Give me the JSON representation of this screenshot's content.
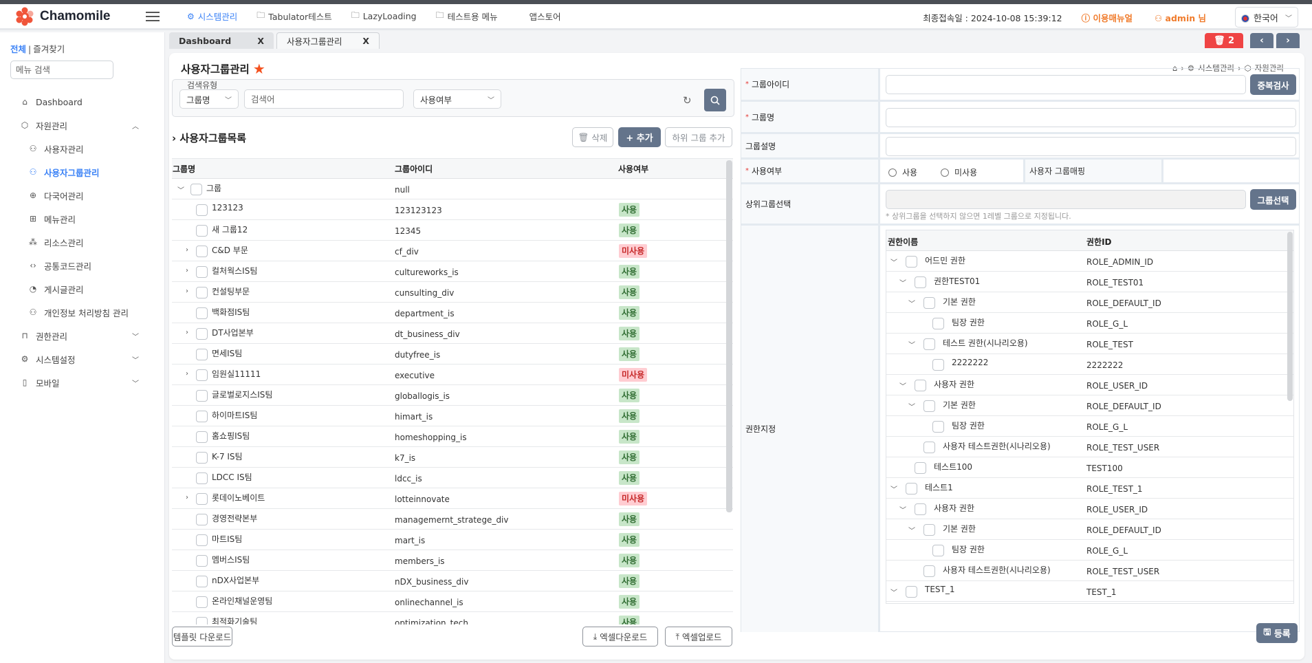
{
  "header": {
    "app_name": "Chamomile",
    "nav": [
      {
        "label": "시스템관리",
        "icon": "gear-icon",
        "active": true
      },
      {
        "label": "Tabulator테스트",
        "icon": "folder-icon"
      },
      {
        "label": "LazyLoading",
        "icon": "folder-icon"
      },
      {
        "label": "테스트용 메뉴",
        "icon": "folder-icon"
      },
      {
        "label": "앱스토어",
        "icon": ""
      }
    ],
    "last_login": "최종접속일 : 2024-10-08 15:39:12",
    "manual_label": "이용매뉴얼",
    "user_label": "admin 님",
    "language": "한국어",
    "accent_color": "#3b82f6",
    "highlight_color": "#f07b2b"
  },
  "sidebar": {
    "tab_all": "전체",
    "tab_separator": "|",
    "tab_favorites": "즐겨찾기",
    "search_placeholder": "메뉴 검색",
    "items": [
      {
        "label": "Dashboard",
        "icon": "home-icon",
        "level": 1
      },
      {
        "label": "자원관리",
        "icon": "cube-icon",
        "level": 1,
        "expanded": true
      },
      {
        "label": "사용자관리",
        "icon": "user-icon",
        "level": 2
      },
      {
        "label": "사용자그룹관리",
        "icon": "users-icon",
        "level": 2,
        "active": true
      },
      {
        "label": "다국어관리",
        "icon": "globe-icon",
        "level": 2
      },
      {
        "label": "메뉴관리",
        "icon": "grid-icon",
        "level": 2
      },
      {
        "label": "리소스관리",
        "icon": "hierarchy-icon",
        "level": 2
      },
      {
        "label": "공통코드관리",
        "icon": "code-icon",
        "level": 2
      },
      {
        "label": "게시글관리",
        "icon": "clipboard-icon",
        "level": 2
      },
      {
        "label": "개인정보 처리방침 관리",
        "icon": "user-icon",
        "level": 2
      },
      {
        "label": "권한관리",
        "icon": "unlock-icon",
        "level": 1,
        "expanded": false
      },
      {
        "label": "시스템설정",
        "icon": "gear-icon",
        "level": 1,
        "expanded": false
      },
      {
        "label": "모바일",
        "icon": "mobile-icon",
        "level": 1,
        "expanded": false
      }
    ]
  },
  "tabs": [
    {
      "label": "Dashboard",
      "close": "X"
    },
    {
      "label": "사용자그룹관리",
      "close": "X",
      "active": true
    }
  ],
  "tab_tools": {
    "trash_count": "2",
    "prev": "‹",
    "next": "›"
  },
  "page": {
    "title": "사용자그룹관리",
    "breadcrumb": [
      "시스템관리",
      "자원관리"
    ],
    "search": {
      "label": "검색유형",
      "type_value": "그룹명",
      "keyword_placeholder": "검색어",
      "use_value": "사용여부"
    },
    "list_title": "사용자그룹목록",
    "buttons": {
      "delete": "삭제",
      "add": "+ 추가",
      "add_sub": "하위 그룹 추가"
    },
    "columns": [
      "그룹명",
      "그룹아이디",
      "사용여부"
    ],
    "rows": [
      {
        "name": "그룹",
        "id": "null",
        "status": "",
        "level": 0,
        "expander": "open"
      },
      {
        "name": "123123",
        "id": "123123123",
        "status": "사용",
        "level": 1,
        "expander": ""
      },
      {
        "name": "새 그룹12",
        "id": "12345",
        "status": "사용",
        "level": 1,
        "expander": ""
      },
      {
        "name": "C&D 부문",
        "id": "cf_div",
        "status": "미사용",
        "level": 1,
        "expander": "closed"
      },
      {
        "name": "컬처웍스IS팀",
        "id": "cultureworks_is",
        "status": "사용",
        "level": 1,
        "expander": "closed"
      },
      {
        "name": "컨설팅부문",
        "id": "cunsulting_div",
        "status": "사용",
        "level": 1,
        "expander": "closed"
      },
      {
        "name": "백화점IS팀",
        "id": "department_is",
        "status": "사용",
        "level": 1,
        "expander": ""
      },
      {
        "name": "DT사업본부",
        "id": "dt_business_div",
        "status": "사용",
        "level": 1,
        "expander": "closed"
      },
      {
        "name": "면세IS팀",
        "id": "dutyfree_is",
        "status": "사용",
        "level": 1,
        "expander": ""
      },
      {
        "name": "임원실11111",
        "id": "executive",
        "status": "미사용",
        "level": 1,
        "expander": "closed"
      },
      {
        "name": "글로벌로지스IS팀",
        "id": "globallogis_is",
        "status": "사용",
        "level": 1,
        "expander": ""
      },
      {
        "name": "하이마트IS팀",
        "id": "himart_is",
        "status": "사용",
        "level": 1,
        "expander": ""
      },
      {
        "name": "홈쇼핑IS팀",
        "id": "homeshopping_is",
        "status": "사용",
        "level": 1,
        "expander": ""
      },
      {
        "name": "K-7 IS팀",
        "id": "k7_is",
        "status": "사용",
        "level": 1,
        "expander": ""
      },
      {
        "name": "LDCC IS팀",
        "id": "ldcc_is",
        "status": "사용",
        "level": 1,
        "expander": ""
      },
      {
        "name": "롯데이노베이트",
        "id": "lotteinnovate",
        "status": "미사용",
        "level": 1,
        "expander": "closed"
      },
      {
        "name": "경영전략본부",
        "id": "managemernt_stratege_div",
        "status": "사용",
        "level": 1,
        "expander": ""
      },
      {
        "name": "마트IS팀",
        "id": "mart_is",
        "status": "사용",
        "level": 1,
        "expander": ""
      },
      {
        "name": "멤버스IS팀",
        "id": "members_is",
        "status": "사용",
        "level": 1,
        "expander": ""
      },
      {
        "name": "nDX사업본부",
        "id": "nDX_business_div",
        "status": "사용",
        "level": 1,
        "expander": ""
      },
      {
        "name": "온라인채널운영팀",
        "id": "onlinechannel_is",
        "status": "사용",
        "level": 1,
        "expander": ""
      },
      {
        "name": "최적화기술팀",
        "id": "optimization_tech",
        "status": "사용",
        "level": 1,
        "expander": ""
      }
    ],
    "footer": {
      "template_download": "템플릿 다운로드",
      "excel_download": "엑셀다운로드",
      "excel_upload": "엑셀업로드"
    },
    "status_colors": {
      "on_bg": "#c8e6c9",
      "on_fg": "#2e6b30",
      "off_bg": "#ffcdd2",
      "off_fg": "#c62828"
    }
  },
  "form": {
    "group_id_label": "그룹아이디",
    "group_id_value": "",
    "dup_check": "중복검사",
    "group_name_label": "그룹명",
    "group_name_value": "",
    "group_desc_label": "그룹설명",
    "group_desc_value": "",
    "use_label": "사용여부",
    "use_option_on": "사용",
    "use_option_off": "미사용",
    "mapping_label": "사용자 그룹매핑",
    "parent_label": "상위그룹선택",
    "parent_value": "",
    "group_select": "그룹선택",
    "parent_hint": "* 상위그룹을 선택하지 않으면 1레벨 그룹으로 지정됩니다.",
    "role_label": "권한지정",
    "role_columns": [
      "권한이름",
      "권한ID"
    ],
    "roles": [
      {
        "name": "어드민 권한",
        "id": "ROLE_ADMIN_ID",
        "level": 0,
        "expander": "open"
      },
      {
        "name": "권한TEST01",
        "id": "ROLE_TEST01",
        "level": 1,
        "expander": "open"
      },
      {
        "name": "기본 권한",
        "id": "ROLE_DEFAULT_ID",
        "level": 2,
        "expander": "open"
      },
      {
        "name": "팀장 권한",
        "id": "ROLE_G_L",
        "level": 3,
        "expander": ""
      },
      {
        "name": "테스트 권한(시나리오용)",
        "id": "ROLE_TEST",
        "level": 2,
        "expander": "open"
      },
      {
        "name": "2222222",
        "id": "2222222",
        "level": 3,
        "expander": ""
      },
      {
        "name": "사용자 권한",
        "id": "ROLE_USER_ID",
        "level": 1,
        "expander": "open"
      },
      {
        "name": "기본 권한",
        "id": "ROLE_DEFAULT_ID",
        "level": 2,
        "expander": "open"
      },
      {
        "name": "팀장 권한",
        "id": "ROLE_G_L",
        "level": 3,
        "expander": ""
      },
      {
        "name": "사용자 테스트권한(시나리오용)",
        "id": "ROLE_TEST_USER",
        "level": 2,
        "expander": ""
      },
      {
        "name": "테스트100",
        "id": "TEST100",
        "level": 1,
        "expander": ""
      },
      {
        "name": "테스트1",
        "id": "ROLE_TEST_1",
        "level": 0,
        "expander": "open"
      },
      {
        "name": "사용자 권한",
        "id": "ROLE_USER_ID",
        "level": 1,
        "expander": "open"
      },
      {
        "name": "기본 권한",
        "id": "ROLE_DEFAULT_ID",
        "level": 2,
        "expander": "open"
      },
      {
        "name": "팀장 권한",
        "id": "ROLE_G_L",
        "level": 3,
        "expander": ""
      },
      {
        "name": "사용자 테스트권한(시나리오용)",
        "id": "ROLE_TEST_USER",
        "level": 2,
        "expander": ""
      },
      {
        "name": "TEST_1",
        "id": "TEST_1",
        "level": 0,
        "expander": "open"
      }
    ],
    "save": "등록"
  }
}
